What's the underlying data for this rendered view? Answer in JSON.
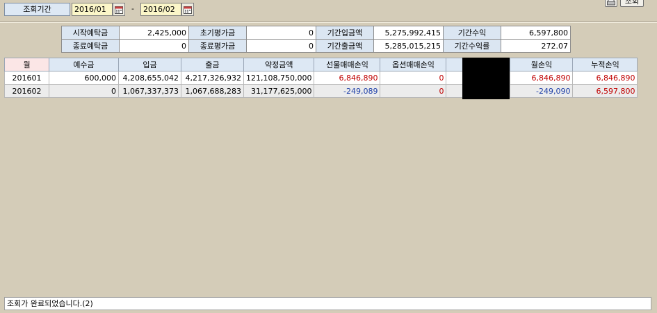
{
  "query": {
    "period_label": "조회기간",
    "start": "2016/01",
    "separator": "-",
    "end": "2016/02",
    "search_button": "조회"
  },
  "summary": {
    "row1": [
      {
        "label": "시작예탁금",
        "value": "2,425,000"
      },
      {
        "label": "초기평가금",
        "value": "0"
      },
      {
        "label": "기간입금액",
        "value": "5,275,992,415"
      },
      {
        "label": "기간수익",
        "value": "6,597,800"
      }
    ],
    "row2": [
      {
        "label": "종료예탁금",
        "value": "0"
      },
      {
        "label": "종료평가금",
        "value": "0"
      },
      {
        "label": "기간출금액",
        "value": "5,285,015,215"
      },
      {
        "label": "기간수익률",
        "value": "272.07"
      }
    ]
  },
  "table": {
    "headers": [
      "월",
      "예수금",
      "입금",
      "출금",
      "약정금액",
      "선물매매손익",
      "옵션매매손익",
      "",
      "",
      "월손익",
      "누적손익"
    ],
    "rows": [
      [
        "201601",
        "600,000",
        "4,208,655,042",
        "4,217,326,932",
        "121,108,750,000",
        "6,846,890",
        "0",
        "",
        "",
        "6,846,890",
        "6,846,890"
      ],
      [
        "201602",
        "0",
        "1,067,337,373",
        "1,067,688,283",
        "31,177,625,000",
        "-249,089",
        "0",
        "",
        "",
        "-249,090",
        "6,597,800"
      ]
    ]
  },
  "status": {
    "message": "조회가 완료되었습니다.(2)"
  },
  "colors": {
    "positive": "#c00000",
    "negative": "#1e3fa8",
    "header_bg": "#dde8f4",
    "date_bg": "#fbf6c8",
    "panel_bg": "#d4ccb8"
  }
}
